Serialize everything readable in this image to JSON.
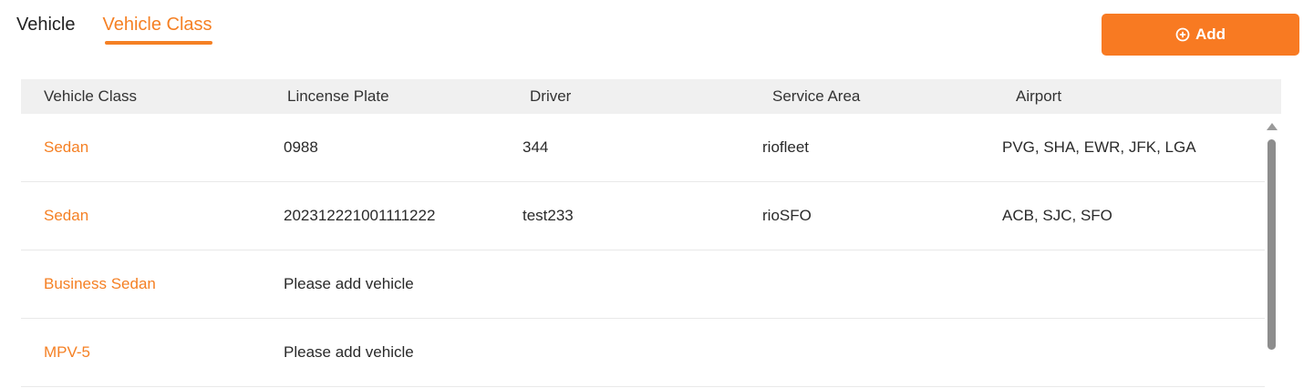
{
  "tabs": [
    {
      "label": "Vehicle",
      "active": false
    },
    {
      "label": "Vehicle Class",
      "active": true
    }
  ],
  "add_button": {
    "label": "Add",
    "icon": "plus-circle-icon"
  },
  "colors": {
    "accent": "#f58024",
    "button": "#f87a22",
    "header_bg": "#f0f0f0"
  },
  "table": {
    "headers": [
      "Vehicle Class",
      "Lincense Plate",
      "Driver",
      "Service Area",
      "Airport"
    ],
    "rows": [
      {
        "vehicle_class": "Sedan",
        "license_plate": "0988",
        "driver": "344",
        "service_area": "riofleet",
        "airport": "PVG, SHA, EWR, JFK, LGA"
      },
      {
        "vehicle_class": "Sedan",
        "license_plate": "202312221001111222",
        "driver": "test233",
        "service_area": "rioSFO",
        "airport": "ACB, SJC, SFO"
      },
      {
        "vehicle_class": "Business Sedan",
        "license_plate": "Please add vehicle",
        "driver": "",
        "service_area": "",
        "airport": ""
      },
      {
        "vehicle_class": "MPV-5",
        "license_plate": "Please add vehicle",
        "driver": "",
        "service_area": "",
        "airport": ""
      }
    ]
  }
}
